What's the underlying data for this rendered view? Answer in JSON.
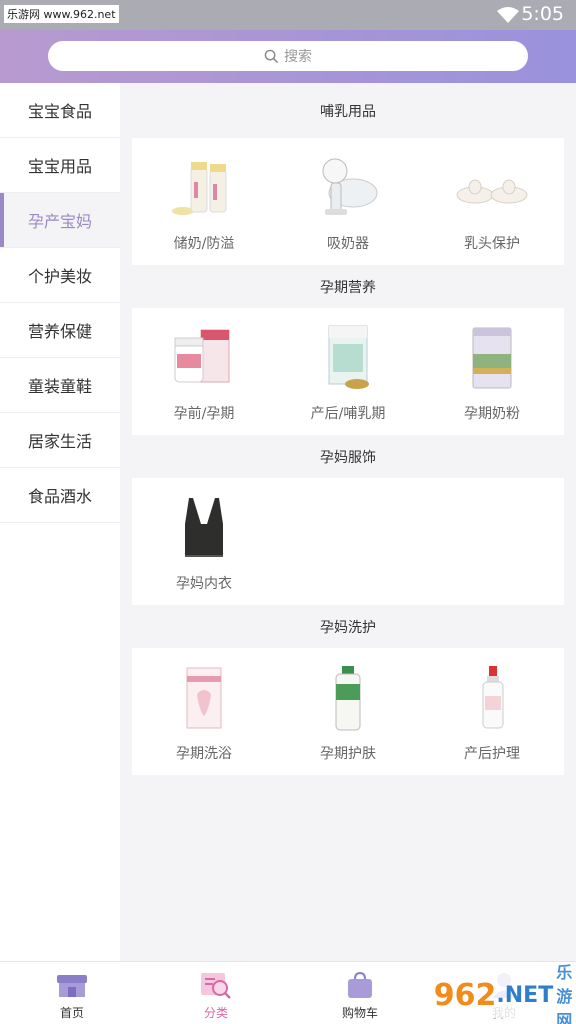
{
  "status_bar": {
    "watermark": "乐游网 www.962.net",
    "time": "5:05"
  },
  "search": {
    "placeholder": "搜索"
  },
  "sidebar": {
    "items": [
      {
        "label": "宝宝食品"
      },
      {
        "label": "宝宝用品"
      },
      {
        "label": "孕产宝妈"
      },
      {
        "label": "个护美妆"
      },
      {
        "label": "营养保健"
      },
      {
        "label": "童装童鞋"
      },
      {
        "label": "居家生活"
      },
      {
        "label": "食品酒水"
      }
    ],
    "active_index": 2,
    "active_color": "#9b89c7"
  },
  "sections": [
    {
      "title": "哺乳用品",
      "items": [
        {
          "label": "储奶/防溢"
        },
        {
          "label": "吸奶器"
        },
        {
          "label": "乳头保护"
        }
      ]
    },
    {
      "title": "孕期营养",
      "items": [
        {
          "label": "孕前/孕期"
        },
        {
          "label": "产后/哺乳期"
        },
        {
          "label": "孕期奶粉"
        }
      ]
    },
    {
      "title": "孕妈服饰",
      "items": [
        {
          "label": "孕妈内衣"
        }
      ]
    },
    {
      "title": "孕妈洗护",
      "items": [
        {
          "label": "孕期洗浴"
        },
        {
          "label": "孕期护肤"
        },
        {
          "label": "产后护理"
        }
      ]
    }
  ],
  "tabbar": {
    "items": [
      {
        "label": "首页"
      },
      {
        "label": "分类"
      },
      {
        "label": "购物车"
      },
      {
        "label": "我的"
      }
    ],
    "active_index": 1,
    "active_color": "#d66aa6"
  },
  "bottom_watermark": {
    "number": "962",
    "net": ".NET",
    "site": "乐游网"
  }
}
